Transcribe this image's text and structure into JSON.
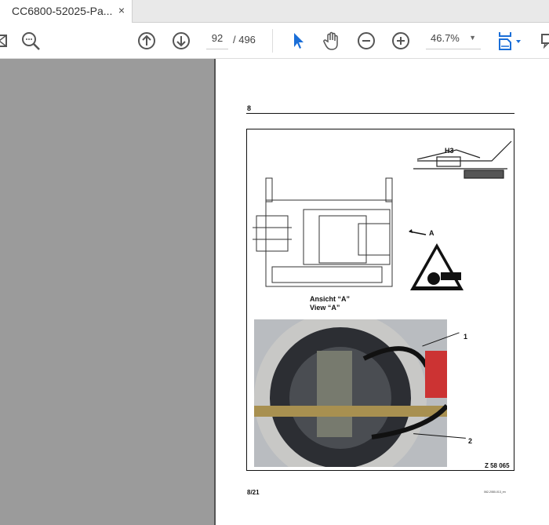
{
  "tab": {
    "title": "CC6800-52025-Pa...",
    "close": "×"
  },
  "toolbar": {
    "page_current": "92",
    "page_separator": "/ 496",
    "zoom": "46.7%"
  },
  "document": {
    "section_number": "8",
    "label_h3": "H3",
    "label_a": "A",
    "view_de": "Ansicht “A”",
    "view_en": "View “A”",
    "callout_1": "1",
    "callout_2": "2",
    "figure_id": "Z 58 065",
    "page_footer": "8/21",
    "footer_code": "062-2080-013_en"
  },
  "colors": {
    "accent": "#1a6ed8",
    "pane": "#9b9b9b"
  }
}
